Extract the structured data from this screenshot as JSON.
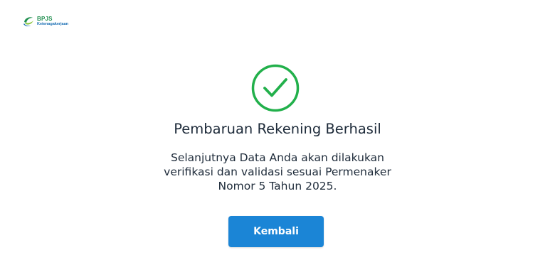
{
  "brand": {
    "name": "BPJS",
    "subtitle": "Ketenagakerjaan",
    "icon": "bpjs-logo-icon"
  },
  "status": {
    "icon": "checkmark-circle-icon",
    "color": "#22b04b"
  },
  "title": "Pembaruan Rekening Berhasil",
  "message": {
    "line1": "Selanjutnya Data Anda akan dilakukan",
    "line2": "verifikasi dan validasi sesuai Permenaker",
    "line3": "Nomor 5 Tahun 2025."
  },
  "actions": {
    "back_label": "Kembali",
    "back_color": "#1b85d6"
  }
}
